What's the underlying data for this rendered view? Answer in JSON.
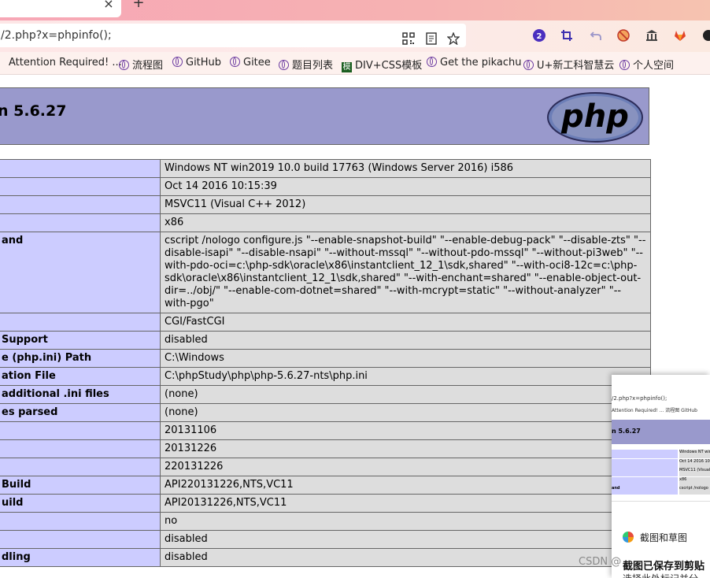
{
  "browser": {
    "tab": {
      "close_glyph": "×",
      "new_tab_glyph": "+"
    },
    "url": "/2.php?x=phpinfo();",
    "toolbar_icons": [
      "qr-code-icon",
      "reader-view-icon",
      "bookmark-star-icon",
      "extension-badge-icon",
      "crop-icon",
      "undo-icon",
      "blocked-icon",
      "institution-icon",
      "gitlab-icon",
      "profile-icon"
    ],
    "extension_badge_count": "2",
    "bookmarks": [
      {
        "label": "Attention Required! ..."
      },
      {
        "label": "流程图"
      },
      {
        "label": "GitHub"
      },
      {
        "label": "Gitee"
      },
      {
        "label": "题目列表"
      },
      {
        "label": "DIV+CSS模板",
        "icon_text": "模"
      },
      {
        "label": "Get the pikachu"
      },
      {
        "label": "U+新工科智慧云"
      },
      {
        "label": "个人空间"
      }
    ]
  },
  "phpinfo": {
    "title": "n 5.6.27",
    "logo_text": "php",
    "rows": [
      {
        "key": "",
        "value": "Windows NT win2019 10.0 build 17763 (Windows Server 2016) i586"
      },
      {
        "key": "",
        "value": "Oct 14 2016 10:15:39"
      },
      {
        "key": "",
        "value": "MSVC11 (Visual C++ 2012)"
      },
      {
        "key": "",
        "value": "x86"
      },
      {
        "key": "and",
        "value": "cscript /nologo configure.js \"--enable-snapshot-build\" \"--enable-debug-pack\" \"--disable-zts\" \"--disable-isapi\" \"--disable-nsapi\" \"--without-mssql\" \"--without-pdo-mssql\" \"--without-pi3web\" \"--with-pdo-oci=c:\\php-sdk\\oracle\\x86\\instantclient_12_1\\sdk,shared\" \"--with-oci8-12c=c:\\php-sdk\\oracle\\x86\\instantclient_12_1\\sdk,shared\" \"--with-enchant=shared\" \"--enable-object-out-dir=../obj/\" \"--enable-com-dotnet=shared\" \"--with-mcrypt=static\" \"--without-analyzer\" \"--with-pgo\""
      },
      {
        "key": "",
        "value": "CGI/FastCGI"
      },
      {
        "key": "Support",
        "value": "disabled"
      },
      {
        "key": "e (php.ini) Path",
        "value": "C:\\Windows"
      },
      {
        "key": "ation File",
        "value": "C:\\phpStudy\\php\\php-5.6.27-nts\\php.ini"
      },
      {
        "key": "additional .ini files",
        "value": "(none)"
      },
      {
        "key": "es parsed",
        "value": "(none)"
      },
      {
        "key": "",
        "value": "20131106"
      },
      {
        "key": "",
        "value": "20131226"
      },
      {
        "key": "",
        "value": "220131226"
      },
      {
        "key": "Build",
        "value": "API220131226,NTS,VC11"
      },
      {
        "key": "uild",
        "value": "API20131226,NTS,VC11"
      },
      {
        "key": "",
        "value": "no"
      },
      {
        "key": "",
        "value": "disabled"
      },
      {
        "key": "dling",
        "value": "disabled"
      }
    ]
  },
  "snip_popup": {
    "thumbnail": {
      "url": "/2.php?x=phpinfo();",
      "bookmarks": "Attention Required! ...  流程图  GitHub",
      "title": "n 5.6.27",
      "rows": [
        {
          "key": "",
          "value": "Windows NT win"
        },
        {
          "key": "",
          "value": "Oct 14 2016 10:1"
        },
        {
          "key": "",
          "value": "MSVC11 (Visual"
        },
        {
          "key": "",
          "value": "x86"
        },
        {
          "key": "and",
          "value": "cscript /nologo"
        }
      ]
    },
    "app_label": "截图和草图",
    "saved_text": "截图已保存到剪贴",
    "saved_subtext": "选择此处标记并分"
  },
  "watermark": "CSDN @"
}
